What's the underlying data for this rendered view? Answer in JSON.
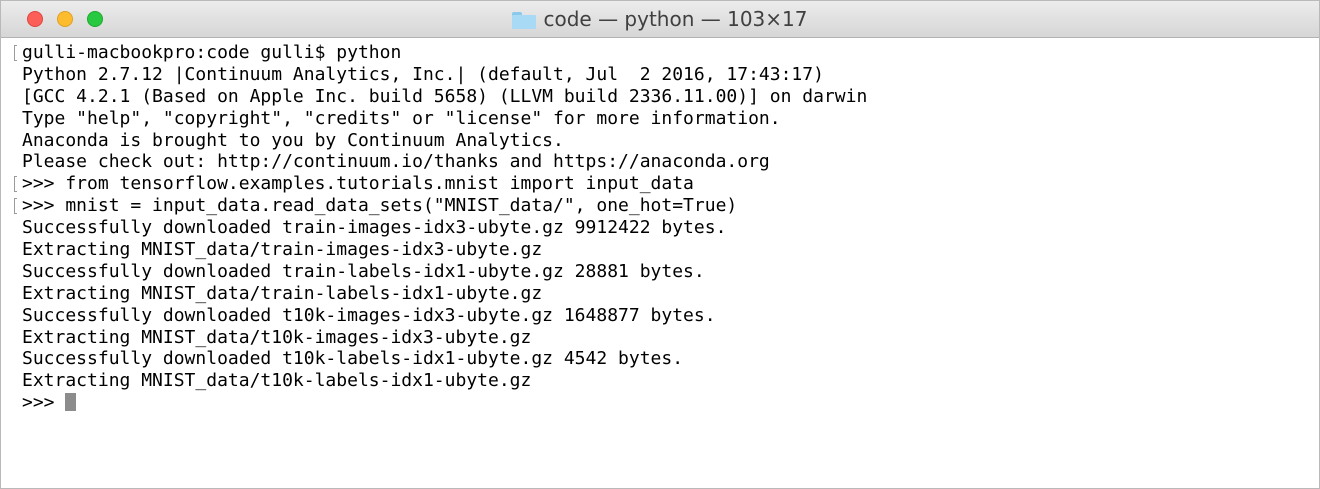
{
  "window": {
    "title": "code — python — 103×17",
    "icon": "folder-icon",
    "buttons": {
      "close_color": "#fc5f57",
      "minimize_color": "#fdbc2e",
      "zoom_color": "#28c840"
    }
  },
  "terminal": {
    "lines": [
      "gulli-macbookpro:code gulli$ python",
      "Python 2.7.12 |Continuum Analytics, Inc.| (default, Jul  2 2016, 17:43:17)",
      "[GCC 4.2.1 (Based on Apple Inc. build 5658) (LLVM build 2336.11.00)] on darwin",
      "Type \"help\", \"copyright\", \"credits\" or \"license\" for more information.",
      "Anaconda is brought to you by Continuum Analytics.",
      "Please check out: http://continuum.io/thanks and https://anaconda.org",
      ">>> from tensorflow.examples.tutorials.mnist import input_data",
      ">>> mnist = input_data.read_data_sets(\"MNIST_data/\", one_hot=True)",
      "Successfully downloaded train-images-idx3-ubyte.gz 9912422 bytes.",
      "Extracting MNIST_data/train-images-idx3-ubyte.gz",
      "Successfully downloaded train-labels-idx1-ubyte.gz 28881 bytes.",
      "Extracting MNIST_data/train-labels-idx1-ubyte.gz",
      "Successfully downloaded t10k-images-idx3-ubyte.gz 1648877 bytes.",
      "Extracting MNIST_data/t10k-images-idx3-ubyte.gz",
      "Successfully downloaded t10k-labels-idx1-ubyte.gz 4542 bytes.",
      "Extracting MNIST_data/t10k-labels-idx1-ubyte.gz",
      ">>> "
    ],
    "text_color": "#000000",
    "cursor_color": "#8c8c8c"
  }
}
